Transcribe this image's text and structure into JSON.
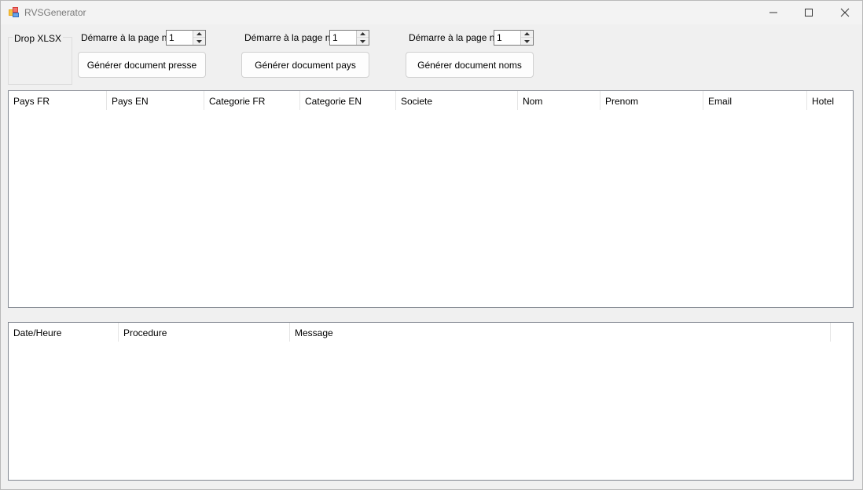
{
  "window": {
    "title": "RVSGenerator"
  },
  "drop_group": {
    "label": "Drop XLSX"
  },
  "controls": [
    {
      "start_label": "Démarre à la page n°",
      "start_value": "1",
      "button_label": "Générer document presse"
    },
    {
      "start_label": "Démarre à la page n°",
      "start_value": "1",
      "button_label": "Générer document pays"
    },
    {
      "start_label": "Démarre à la page n°",
      "start_value": "1",
      "button_label": "Générer document noms"
    }
  ],
  "data_table": {
    "columns": [
      "Pays FR",
      "Pays EN",
      "Categorie FR",
      "Categorie EN",
      "Societe",
      "Nom",
      "Prenom",
      "Email",
      "Hotel"
    ],
    "rows": []
  },
  "log_table": {
    "columns": [
      "Date/Heure",
      "Procedure",
      "Message"
    ],
    "rows": []
  },
  "icons": {
    "app": "app-icon",
    "minimize": "minimize-icon",
    "maximize": "maximize-icon",
    "close": "close-icon"
  }
}
